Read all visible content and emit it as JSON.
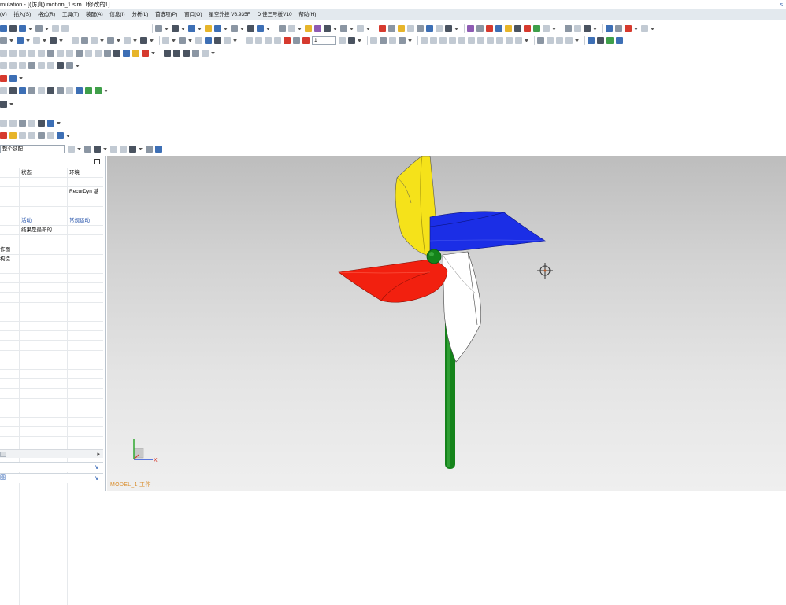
{
  "window": {
    "title": "mulation - [(仿真) motion_1.sim（修改的）]",
    "right_text": "s"
  },
  "menu": [
    "(V)",
    "插入(S)",
    "格式(R)",
    "工具(T)",
    "装配(A)",
    "信息(I)",
    "分析(L)",
    "首选项(P)",
    "窗口(O)",
    "星空外挂 V6.935F",
    "D 佳三号板V10",
    "帮助(H)"
  ],
  "toolbar": {
    "frame_input": "1",
    "filter_select": "整个装配"
  },
  "navigator": {
    "columns": [
      "状态",
      "环境"
    ],
    "rows": [
      {
        "c1": "",
        "c2": "",
        "c3": "RecurDyn 基"
      },
      {
        "c1": "",
        "c2": "",
        "c3": ""
      },
      {
        "c1": "",
        "c2": "",
        "c3": ""
      },
      {
        "c1": "",
        "c2": "活动",
        "c3": "常规运动"
      },
      {
        "c1": "",
        "c2": "结果是最新的",
        "c3": ""
      },
      {
        "c1": "",
        "c2": "",
        "c3": ""
      },
      {
        "c1": "作图",
        "c2": "",
        "c3": ""
      },
      {
        "c1": "构造",
        "c2": "",
        "c3": ""
      }
    ],
    "sub_panel_1_label": "",
    "sub_panel_2_label": "图"
  },
  "viewport": {
    "label": "MODEL_1 工作",
    "triad_x_label": "X"
  },
  "colors": {
    "blade_yellow": "#f5e21a",
    "blade_blue": "#1b2ee6",
    "blade_red": "#f2200f",
    "blade_white": "#ffffff",
    "stick_green": "#14831a",
    "menubar_bg": "#e3e9ee",
    "link_blue": "#1f4ea8"
  }
}
